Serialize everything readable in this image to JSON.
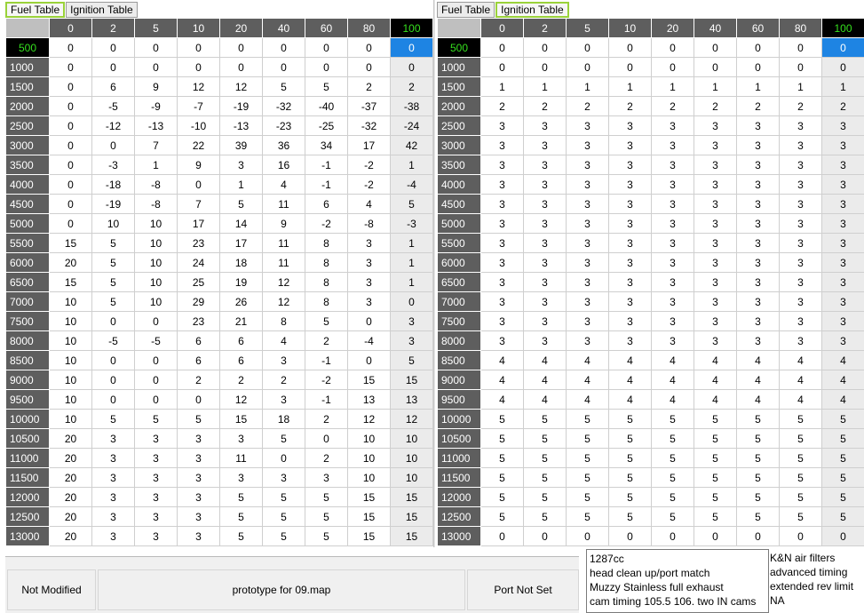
{
  "tabs": [
    "Fuel Table",
    "Ignition Table"
  ],
  "fuel_table": {
    "active_tab": 0,
    "columns": [
      "0",
      "2",
      "5",
      "10",
      "20",
      "40",
      "60",
      "80",
      "100"
    ],
    "rows": [
      {
        "rpm": "500",
        "cells": [
          "0",
          "0",
          "0",
          "0",
          "0",
          "0",
          "0",
          "0",
          "0"
        ]
      },
      {
        "rpm": "1000",
        "cells": [
          "0",
          "0",
          "0",
          "0",
          "0",
          "0",
          "0",
          "0",
          "0"
        ]
      },
      {
        "rpm": "1500",
        "cells": [
          "0",
          "6",
          "9",
          "12",
          "12",
          "5",
          "5",
          "2",
          "2"
        ]
      },
      {
        "rpm": "2000",
        "cells": [
          "0",
          "-5",
          "-9",
          "-7",
          "-19",
          "-32",
          "-40",
          "-37",
          "-38"
        ]
      },
      {
        "rpm": "2500",
        "cells": [
          "0",
          "-12",
          "-13",
          "-10",
          "-13",
          "-23",
          "-25",
          "-32",
          "-24"
        ]
      },
      {
        "rpm": "3000",
        "cells": [
          "0",
          "0",
          "7",
          "22",
          "39",
          "36",
          "34",
          "17",
          "42"
        ]
      },
      {
        "rpm": "3500",
        "cells": [
          "0",
          "-3",
          "1",
          "9",
          "3",
          "16",
          "-1",
          "-2",
          "1"
        ]
      },
      {
        "rpm": "4000",
        "cells": [
          "0",
          "-18",
          "-8",
          "0",
          "1",
          "4",
          "-1",
          "-2",
          "-4"
        ]
      },
      {
        "rpm": "4500",
        "cells": [
          "0",
          "-19",
          "-8",
          "7",
          "5",
          "11",
          "6",
          "4",
          "5"
        ]
      },
      {
        "rpm": "5000",
        "cells": [
          "0",
          "10",
          "10",
          "17",
          "14",
          "9",
          "-2",
          "-8",
          "-3"
        ]
      },
      {
        "rpm": "5500",
        "cells": [
          "15",
          "5",
          "10",
          "23",
          "17",
          "11",
          "8",
          "3",
          "1"
        ]
      },
      {
        "rpm": "6000",
        "cells": [
          "20",
          "5",
          "10",
          "24",
          "18",
          "11",
          "8",
          "3",
          "1"
        ]
      },
      {
        "rpm": "6500",
        "cells": [
          "15",
          "5",
          "10",
          "25",
          "19",
          "12",
          "8",
          "3",
          "1"
        ]
      },
      {
        "rpm": "7000",
        "cells": [
          "10",
          "5",
          "10",
          "29",
          "26",
          "12",
          "8",
          "3",
          "0"
        ]
      },
      {
        "rpm": "7500",
        "cells": [
          "10",
          "0",
          "0",
          "23",
          "21",
          "8",
          "5",
          "0",
          "3"
        ]
      },
      {
        "rpm": "8000",
        "cells": [
          "10",
          "-5",
          "-5",
          "6",
          "6",
          "4",
          "2",
          "-4",
          "3"
        ]
      },
      {
        "rpm": "8500",
        "cells": [
          "10",
          "0",
          "0",
          "6",
          "6",
          "3",
          "-1",
          "0",
          "5"
        ]
      },
      {
        "rpm": "9000",
        "cells": [
          "10",
          "0",
          "0",
          "2",
          "2",
          "2",
          "-2",
          "15",
          "15"
        ]
      },
      {
        "rpm": "9500",
        "cells": [
          "10",
          "0",
          "0",
          "0",
          "12",
          "3",
          "-1",
          "13",
          "13"
        ]
      },
      {
        "rpm": "10000",
        "cells": [
          "10",
          "5",
          "5",
          "5",
          "15",
          "18",
          "2",
          "12",
          "12"
        ]
      },
      {
        "rpm": "10500",
        "cells": [
          "20",
          "3",
          "3",
          "3",
          "3",
          "5",
          "0",
          "10",
          "10"
        ]
      },
      {
        "rpm": "11000",
        "cells": [
          "20",
          "3",
          "3",
          "3",
          "11",
          "0",
          "2",
          "10",
          "10"
        ]
      },
      {
        "rpm": "11500",
        "cells": [
          "20",
          "3",
          "3",
          "3",
          "3",
          "3",
          "3",
          "10",
          "10"
        ]
      },
      {
        "rpm": "12000",
        "cells": [
          "20",
          "3",
          "3",
          "3",
          "5",
          "5",
          "5",
          "15",
          "15"
        ]
      },
      {
        "rpm": "12500",
        "cells": [
          "20",
          "3",
          "3",
          "3",
          "5",
          "5",
          "5",
          "15",
          "15"
        ]
      },
      {
        "rpm": "13000",
        "cells": [
          "20",
          "3",
          "3",
          "3",
          "5",
          "5",
          "5",
          "15",
          "15"
        ]
      }
    ]
  },
  "ignition_table": {
    "active_tab": 1,
    "columns": [
      "0",
      "2",
      "5",
      "10",
      "20",
      "40",
      "60",
      "80",
      "100"
    ],
    "rows": [
      {
        "rpm": "500",
        "cells": [
          "0",
          "0",
          "0",
          "0",
          "0",
          "0",
          "0",
          "0",
          "0"
        ]
      },
      {
        "rpm": "1000",
        "cells": [
          "0",
          "0",
          "0",
          "0",
          "0",
          "0",
          "0",
          "0",
          "0"
        ]
      },
      {
        "rpm": "1500",
        "cells": [
          "1",
          "1",
          "1",
          "1",
          "1",
          "1",
          "1",
          "1",
          "1"
        ]
      },
      {
        "rpm": "2000",
        "cells": [
          "2",
          "2",
          "2",
          "2",
          "2",
          "2",
          "2",
          "2",
          "2"
        ]
      },
      {
        "rpm": "2500",
        "cells": [
          "3",
          "3",
          "3",
          "3",
          "3",
          "3",
          "3",
          "3",
          "3"
        ]
      },
      {
        "rpm": "3000",
        "cells": [
          "3",
          "3",
          "3",
          "3",
          "3",
          "3",
          "3",
          "3",
          "3"
        ]
      },
      {
        "rpm": "3500",
        "cells": [
          "3",
          "3",
          "3",
          "3",
          "3",
          "3",
          "3",
          "3",
          "3"
        ]
      },
      {
        "rpm": "4000",
        "cells": [
          "3",
          "3",
          "3",
          "3",
          "3",
          "3",
          "3",
          "3",
          "3"
        ]
      },
      {
        "rpm": "4500",
        "cells": [
          "3",
          "3",
          "3",
          "3",
          "3",
          "3",
          "3",
          "3",
          "3"
        ]
      },
      {
        "rpm": "5000",
        "cells": [
          "3",
          "3",
          "3",
          "3",
          "3",
          "3",
          "3",
          "3",
          "3"
        ]
      },
      {
        "rpm": "5500",
        "cells": [
          "3",
          "3",
          "3",
          "3",
          "3",
          "3",
          "3",
          "3",
          "3"
        ]
      },
      {
        "rpm": "6000",
        "cells": [
          "3",
          "3",
          "3",
          "3",
          "3",
          "3",
          "3",
          "3",
          "3"
        ]
      },
      {
        "rpm": "6500",
        "cells": [
          "3",
          "3",
          "3",
          "3",
          "3",
          "3",
          "3",
          "3",
          "3"
        ]
      },
      {
        "rpm": "7000",
        "cells": [
          "3",
          "3",
          "3",
          "3",
          "3",
          "3",
          "3",
          "3",
          "3"
        ]
      },
      {
        "rpm": "7500",
        "cells": [
          "3",
          "3",
          "3",
          "3",
          "3",
          "3",
          "3",
          "3",
          "3"
        ]
      },
      {
        "rpm": "8000",
        "cells": [
          "3",
          "3",
          "3",
          "3",
          "3",
          "3",
          "3",
          "3",
          "3"
        ]
      },
      {
        "rpm": "8500",
        "cells": [
          "4",
          "4",
          "4",
          "4",
          "4",
          "4",
          "4",
          "4",
          "4"
        ]
      },
      {
        "rpm": "9000",
        "cells": [
          "4",
          "4",
          "4",
          "4",
          "4",
          "4",
          "4",
          "4",
          "4"
        ]
      },
      {
        "rpm": "9500",
        "cells": [
          "4",
          "4",
          "4",
          "4",
          "4",
          "4",
          "4",
          "4",
          "4"
        ]
      },
      {
        "rpm": "10000",
        "cells": [
          "5",
          "5",
          "5",
          "5",
          "5",
          "5",
          "5",
          "5",
          "5"
        ]
      },
      {
        "rpm": "10500",
        "cells": [
          "5",
          "5",
          "5",
          "5",
          "5",
          "5",
          "5",
          "5",
          "5"
        ]
      },
      {
        "rpm": "11000",
        "cells": [
          "5",
          "5",
          "5",
          "5",
          "5",
          "5",
          "5",
          "5",
          "5"
        ]
      },
      {
        "rpm": "11500",
        "cells": [
          "5",
          "5",
          "5",
          "5",
          "5",
          "5",
          "5",
          "5",
          "5"
        ]
      },
      {
        "rpm": "12000",
        "cells": [
          "5",
          "5",
          "5",
          "5",
          "5",
          "5",
          "5",
          "5",
          "5"
        ]
      },
      {
        "rpm": "12500",
        "cells": [
          "5",
          "5",
          "5",
          "5",
          "5",
          "5",
          "5",
          "5",
          "5"
        ]
      },
      {
        "rpm": "13000",
        "cells": [
          "0",
          "0",
          "0",
          "0",
          "0",
          "0",
          "0",
          "0",
          "0"
        ]
      }
    ]
  },
  "highlight": {
    "row_index": 0,
    "col_index": 8
  },
  "colors": {
    "header_bg": "#5e5e5e",
    "highlight_bg": "#000000",
    "highlight_text": "#35e01e",
    "selected_cell": "#1e84e3",
    "active_tab_border": "#9ad23a"
  },
  "status": {
    "modified": "Not Modified",
    "map_name": "prototype for 09.map",
    "port": "Port Not Set"
  },
  "notes": {
    "box_lines": [
      "1287cc",
      "head clean up/port match",
      "Muzzy Stainless full exhaust",
      "cam timing 105.5 106. two IN cams"
    ],
    "side_lines": [
      "K&N air filters",
      "advanced timing",
      "extended rev limit",
      "NA"
    ]
  }
}
